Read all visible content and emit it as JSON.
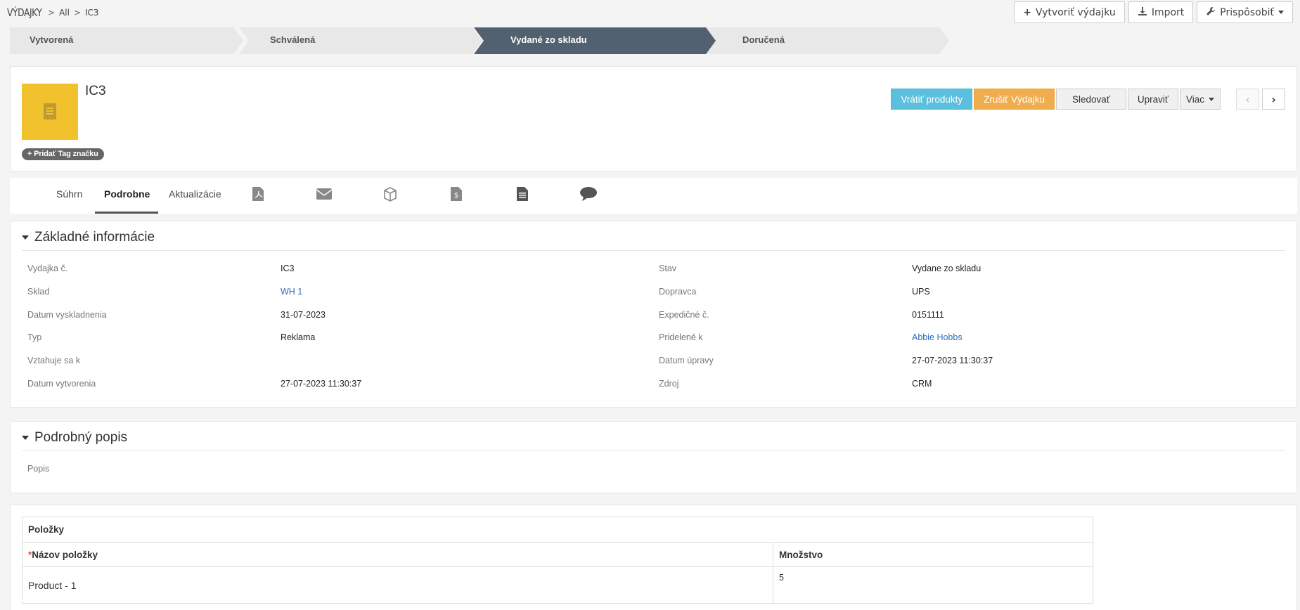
{
  "breadcrumb": {
    "module": "VÝDAJKY",
    "sep": ">",
    "all": "All",
    "current": "IC3"
  },
  "top_actions": {
    "create": "Vytvoriť výdajku",
    "import": "Import",
    "customize": "Prispôsobiť"
  },
  "progress": {
    "steps": [
      "Vytvorená",
      "Schválená",
      "Vydané zo skladu",
      "Doručená"
    ],
    "active_index": 2
  },
  "record": {
    "title": "IC3",
    "add_tag": "+ Pridať Tag značku",
    "icon_color": "#f2c12e",
    "actions": {
      "return": "Vrátiť produkty",
      "cancel": "Zrušiť Výdajku",
      "follow": "Sledovať",
      "edit": "Upraviť",
      "more": "Viac"
    }
  },
  "tabs": {
    "summary": "Súhrn",
    "detail": "Podrobne",
    "updates": "Aktualizácie",
    "active": "Podrobne",
    "icons": [
      "pdf-icon",
      "email-icon",
      "box-icon",
      "invoice-icon",
      "document-icon",
      "comment-icon"
    ]
  },
  "basic": {
    "title": "Základné informácie",
    "left": [
      {
        "label": "Vydajka č.",
        "value": "IC3"
      },
      {
        "label": "Sklad",
        "value": "WH 1"
      },
      {
        "label": "Datum vyskladnenia",
        "value": "31-07-2023"
      },
      {
        "label": "Typ",
        "value": "Reklama"
      },
      {
        "label": "Vztahuje sa k",
        "value": ""
      },
      {
        "label": "Datum vytvorenia",
        "value": "27-07-2023 11:30:37"
      }
    ],
    "right": [
      {
        "label": "Stav",
        "value": "Vydane zo skladu"
      },
      {
        "label": "Dopravca",
        "value": "UPS"
      },
      {
        "label": "Expedičné č.",
        "value": "0151111"
      },
      {
        "label": "Pridelené k",
        "value": "Abbie Hobbs"
      },
      {
        "label": "Datum úpravy",
        "value": "27-07-2023 11:30:37"
      },
      {
        "label": "Zdroj",
        "value": "CRM"
      }
    ]
  },
  "description": {
    "title": "Podrobný popis",
    "label": "Popis"
  },
  "items": {
    "title": "Položky",
    "columns": {
      "req": "*",
      "name": "Názov položky",
      "qty": "Množstvo"
    },
    "rows": [
      {
        "name": "Product - 1",
        "qty": "5"
      }
    ]
  },
  "colors": {
    "progress_active": "#526170",
    "info": "#5bc0de",
    "warning": "#f0ad4e",
    "link": "#2a6ebb"
  }
}
